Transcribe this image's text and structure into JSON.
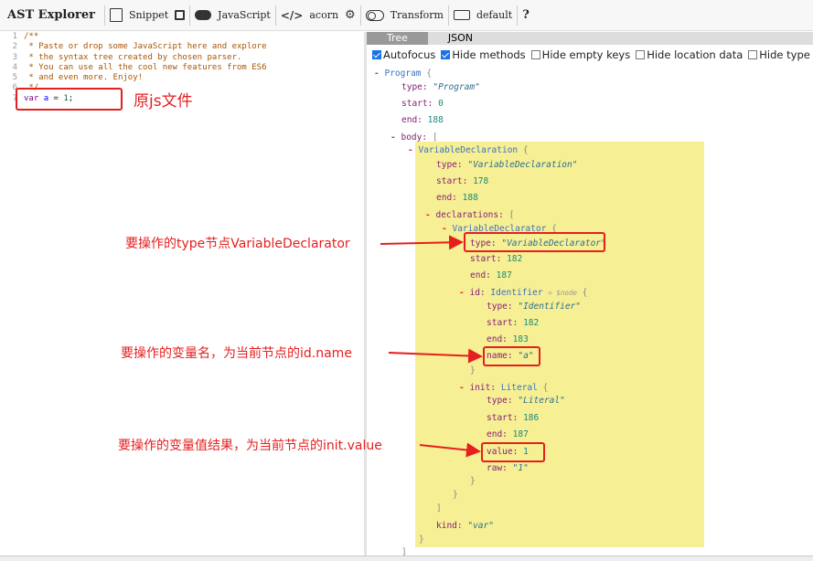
{
  "toolbar": {
    "brand": "AST Explorer",
    "snippet": "Snippet",
    "language": "JavaScript",
    "parser": "acorn",
    "transform": "Transform",
    "keymap": "default",
    "help": "?"
  },
  "editor": {
    "line_numbers": [
      "1",
      "2",
      "3",
      "4",
      "5",
      "6",
      "7"
    ],
    "comment_lines": [
      "/**",
      " * Paste or drop some JavaScript here and explore",
      " * the syntax tree created by chosen parser.",
      " * You can use all the cool new features from ES6",
      " * and even more. Enjoy!",
      " */"
    ],
    "code": {
      "kw": "var",
      "name": "a",
      "op": "=",
      "num": "1",
      "end": ";"
    }
  },
  "output": {
    "tabs": [
      "Tree",
      "JSON"
    ],
    "options": [
      {
        "label": "Autofocus",
        "checked": true
      },
      {
        "label": "Hide methods",
        "checked": true
      },
      {
        "label": "Hide empty keys",
        "checked": false
      },
      {
        "label": "Hide location data",
        "checked": false
      },
      {
        "label": "Hide type keys",
        "checked": false
      }
    ]
  },
  "tree": {
    "program": "Program",
    "program_type": "\"Program\"",
    "program_start": "0",
    "program_end": "188",
    "body": "body:",
    "vd": "VariableDeclaration",
    "vd_type": "\"VariableDeclaration\"",
    "vd_start": "178",
    "vd_end": "188",
    "declarations": "declarations:",
    "vdr": "VariableDeclarator",
    "vdr_type": "\"VariableDeclarator\"",
    "vdr_start": "182",
    "vdr_end": "187",
    "id_label": "id:",
    "identifier": "Identifier",
    "node_hint": "= $node",
    "id_type": "\"Identifier\"",
    "id_start": "182",
    "id_end": "183",
    "id_name": "\"a\"",
    "init_label": "init:",
    "literal": "Literal",
    "init_type": "\"Literal\"",
    "init_start": "186",
    "init_end": "187",
    "init_value": "1",
    "init_raw": "\"1\"",
    "kind": "\"var\"",
    "k_type": "type:",
    "k_start": "start:",
    "k_end": "end:",
    "k_name": "name:",
    "k_value": "value:",
    "k_raw": "raw:",
    "k_kind": "kind:"
  },
  "annotations": {
    "source": "原js文件",
    "type_node": "要操作的type节点VariableDeclarator",
    "var_name": "要操作的变量名，为当前节点的id.name",
    "var_value": "要操作的变量值结果，为当前节点的init.value"
  },
  "colors": {
    "annotation": "#e61e1e",
    "highlight": "#f6ef94",
    "accent": "#1a73e8"
  }
}
